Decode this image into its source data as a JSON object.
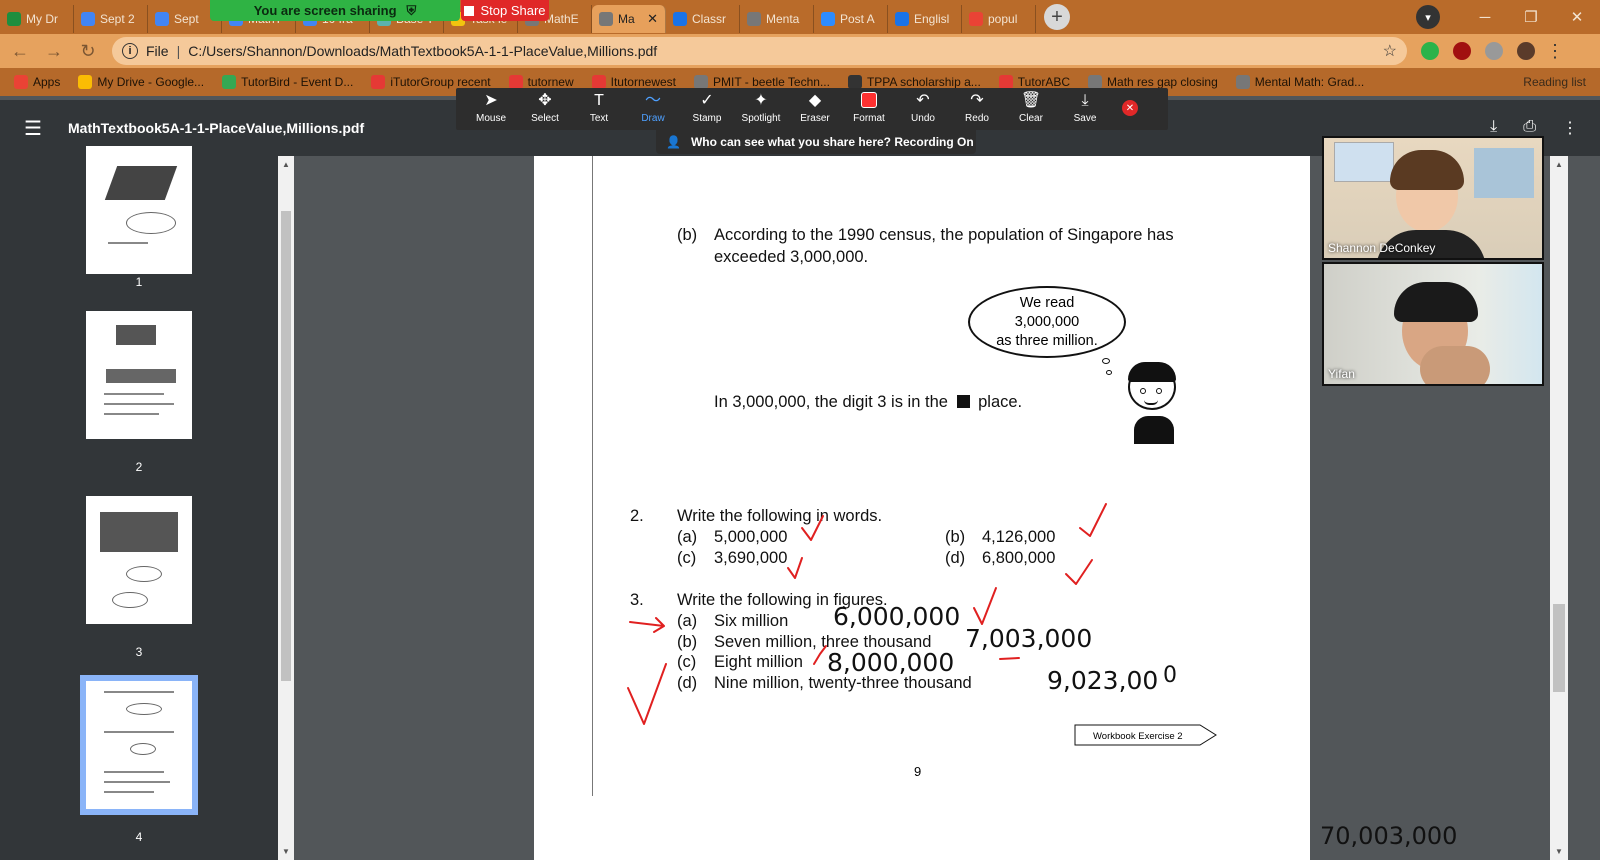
{
  "tabs": [
    {
      "label": "My Dr",
      "icon_color": "#1e8e3e"
    },
    {
      "label": "Sept 2",
      "icon_color": "#4285f4"
    },
    {
      "label": "Sept",
      "icon_color": "#4285f4"
    },
    {
      "label": "MathT",
      "icon_color": "#4285f4"
    },
    {
      "label": "10 fra",
      "icon_color": "#4285f4"
    },
    {
      "label": "Base T",
      "icon_color": "#5bb3b0"
    },
    {
      "label": "Task le",
      "icon_color": "#f2c40f"
    },
    {
      "label": "MathE",
      "icon_color": "#777777"
    },
    {
      "label": "Ma",
      "icon_color": "#777777",
      "active": true
    },
    {
      "label": "Classr",
      "icon_color": "#1a73e8"
    },
    {
      "label": "Menta",
      "icon_color": "#777777"
    },
    {
      "label": "Post A",
      "icon_color": "#2d8cff"
    },
    {
      "label": "Englisl",
      "icon_color": "#1a73e8"
    },
    {
      "label": "popul",
      "icon_color": "#ea4335"
    }
  ],
  "share": {
    "status": "You are screen sharing",
    "stop_label": "Stop Share"
  },
  "address": {
    "scheme": "File",
    "path": "C:/Users/Shannon/Downloads/MathTextbook5A-1-1-PlaceValue,Millions.pdf"
  },
  "bookmarks": [
    {
      "label": "Apps",
      "color": "#ea4335"
    },
    {
      "label": "My Drive - Google...",
      "color": "#fbbc04"
    },
    {
      "label": "TutorBird - Event D...",
      "color": "#34a853"
    },
    {
      "label": "iTutorGroup recent",
      "color": "#e53935"
    },
    {
      "label": "tutornew",
      "color": "#e53935"
    },
    {
      "label": "Itutornewest",
      "color": "#e53935"
    },
    {
      "label": "PMIT - beetle Techn...",
      "color": "#777777"
    },
    {
      "label": "TPPA scholarship a...",
      "color": "#333333"
    },
    {
      "label": "TutorABC",
      "color": "#e53935"
    },
    {
      "label": "Math res gap closing",
      "color": "#777777"
    },
    {
      "label": "Mental Math: Grad...",
      "color": "#777777"
    }
  ],
  "reading_list": "Reading list",
  "pdf": {
    "title": "MathTextbook5A-1-1-PlaceValue,Millions.pdf"
  },
  "thumbnails": [
    {
      "num": "1"
    },
    {
      "num": "2"
    },
    {
      "num": "3"
    },
    {
      "num": "4",
      "selected": true
    }
  ],
  "annotate_tools": [
    {
      "label": "Mouse",
      "glyph": "➤"
    },
    {
      "label": "Select",
      "glyph": "✥"
    },
    {
      "label": "Text",
      "glyph": "T"
    },
    {
      "label": "Draw",
      "glyph": "〜",
      "active": true
    },
    {
      "label": "Stamp",
      "glyph": "✓"
    },
    {
      "label": "Spotlight",
      "glyph": "✦"
    },
    {
      "label": "Eraser",
      "glyph": "◆"
    },
    {
      "label": "Format",
      "glyph": ""
    },
    {
      "label": "Undo",
      "glyph": "↶"
    },
    {
      "label": "Redo",
      "glyph": "↷"
    },
    {
      "label": "Clear",
      "glyph": "🗑"
    },
    {
      "label": "Save",
      "glyph": "⤓"
    }
  ],
  "recording_notice": "Who can see what you share here? Recording On",
  "page": {
    "b_label": "(b)",
    "b_line1": "According to the 1990 census, the population of Singapore has",
    "b_line2": "exceeded 3,000,000.",
    "cloud": [
      "We read",
      "3,000,000",
      "as three million."
    ],
    "digit_before": "In 3,000,000, the digit 3 is in the",
    "digit_after": "place.",
    "q2_num": "2.",
    "q2_title": "Write the following in words.",
    "q2_items": [
      {
        "label": "(a)",
        "value": "5,000,000"
      },
      {
        "label": "(b)",
        "value": "4,126,000"
      },
      {
        "label": "(c)",
        "value": "3,690,000"
      },
      {
        "label": "(d)",
        "value": "6,800,000"
      }
    ],
    "q3_num": "3.",
    "q3_title": "Write the following in figures.",
    "q3_items": [
      {
        "label": "(a)",
        "text": "Six million"
      },
      {
        "label": "(b)",
        "text": "Seven million, three thousand"
      },
      {
        "label": "(c)",
        "text": "Eight million"
      },
      {
        "label": "(d)",
        "text": "Nine million, twenty-three thousand"
      }
    ],
    "handwritten": [
      "6,000,000",
      "7,003,000",
      "8,000,000",
      "9,023,00",
      "0"
    ],
    "workbook_tag": "Workbook Exercise 2",
    "page_number": "9"
  },
  "participants": [
    {
      "name": "Shannon DeConkey"
    },
    {
      "name": "Yifan"
    }
  ],
  "overflow_note": "70,003,000",
  "ink_color": "#e02020"
}
